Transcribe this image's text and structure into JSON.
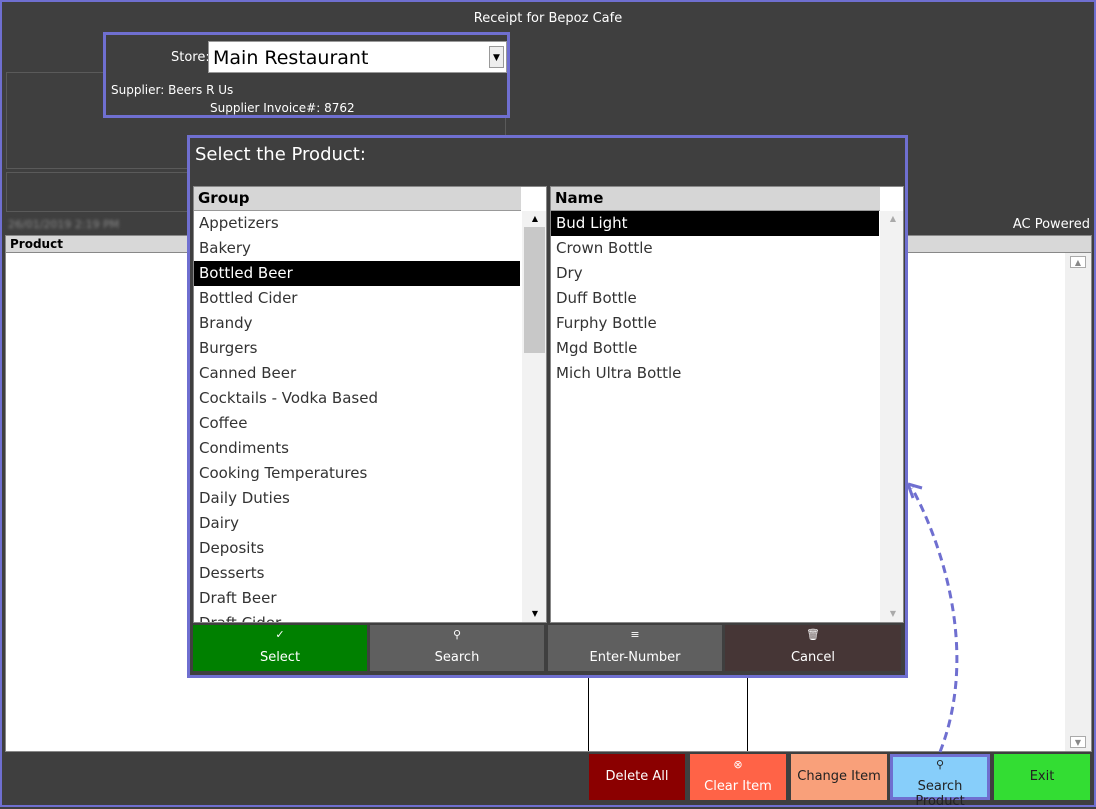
{
  "window": {
    "title": "Receipt for Bepoz Cafe",
    "ac_powered": "AC Powered",
    "date_blurred": "26/01/2019 2:19 PM"
  },
  "header": {
    "store_label": "Store:",
    "store_value": "Main Restaurant",
    "supplier": "Supplier: Beers R Us",
    "invoice": "Supplier Invoice#: 8762"
  },
  "grid": {
    "product_header": "Product"
  },
  "dialog": {
    "title": "Select the Product:",
    "group_header": "Group",
    "name_header": "Name",
    "groups": [
      "Appetizers",
      "Bakery",
      "Bottled Beer",
      "Bottled Cider",
      "Brandy",
      "Burgers",
      "Canned Beer",
      "Cocktails - Vodka Based",
      "Coffee",
      "Condiments",
      "Cooking Temperatures",
      "Daily Duties",
      "Dairy",
      "Deposits",
      "Desserts",
      "Draft Beer",
      "Draft Cider"
    ],
    "group_selected": "Bottled Beer",
    "names": [
      "Bud Light",
      "Crown Bottle",
      "Dry",
      "Duff Bottle",
      "Furphy Bottle",
      "Mgd Bottle",
      "Mich Ultra Bottle"
    ],
    "name_selected": "Bud Light",
    "buttons": {
      "select": "Select",
      "search": "Search",
      "enter_number": "Enter-Number",
      "cancel": "Cancel"
    }
  },
  "actions": {
    "delete_all": "Delete All",
    "clear_item": "Clear Item",
    "change_item": "Change Item",
    "search_product": "Search Product",
    "exit": "Exit"
  },
  "colors": {
    "accent": "#6f6fd0",
    "select_btn": "#008000",
    "grey_btn": "#5f5f5f",
    "cancel_btn": "#463636",
    "delete_all": "#8b0000",
    "clear_item": "#ff6347",
    "change_item": "#f9a07a",
    "search_product": "#87cefa",
    "exit": "#33dd33"
  },
  "icons": {
    "select": "checkmark-icon",
    "search": "magnifier-icon",
    "enter_number": "list-icon",
    "cancel": "wastebasket-icon",
    "clear_item": "clear-circle-icon",
    "search_product": "magnifier-icon"
  }
}
